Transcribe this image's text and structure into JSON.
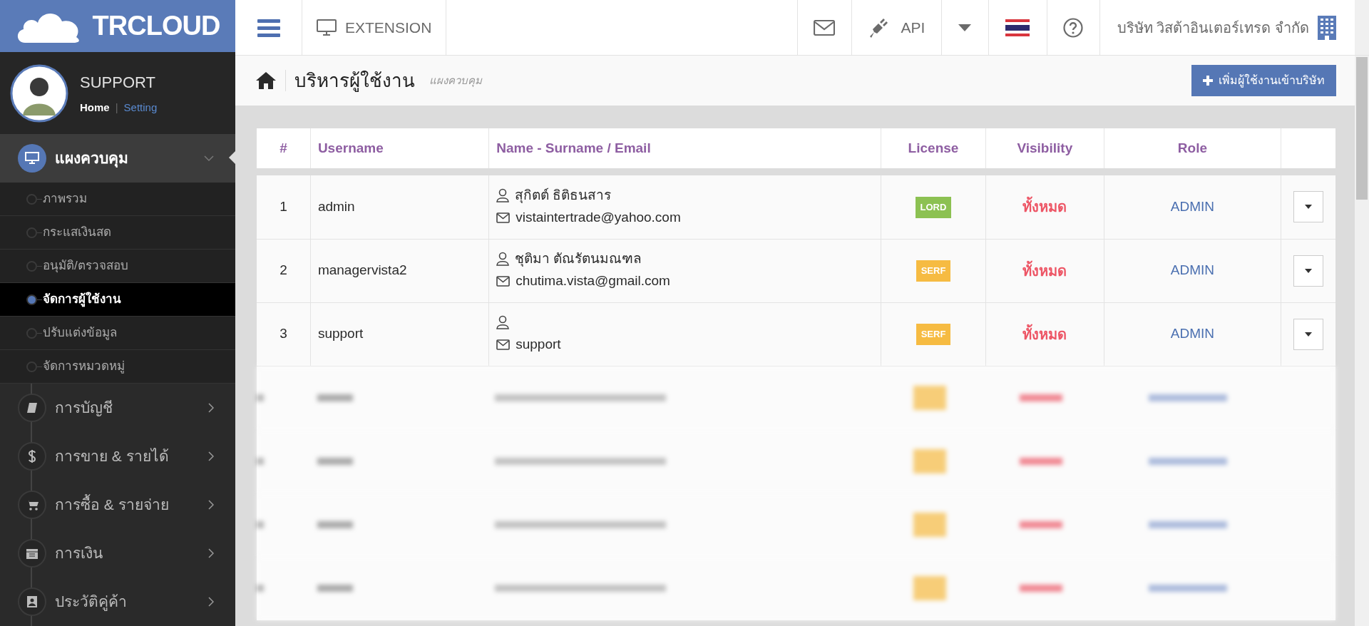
{
  "logo": {
    "text": "TRCLOUD"
  },
  "profile": {
    "name": "SUPPORT",
    "separator": "|",
    "links": [
      {
        "label": "Home",
        "selected": true
      },
      {
        "label": "Setting",
        "selected": false
      }
    ]
  },
  "sidebar": {
    "items": [
      {
        "label": "แผงควบคุม",
        "expanded": true,
        "children": [
          {
            "label": "ภาพรวม",
            "selected": false
          },
          {
            "label": "กระแสเงินสด",
            "selected": false
          },
          {
            "label": "อนุมัติ/ตรวจสอบ",
            "selected": false
          },
          {
            "label": "จัดการผู้ใช้งาน",
            "selected": true
          },
          {
            "label": "ปรับแต่งข้อมูล",
            "selected": false
          },
          {
            "label": "จัดการหมวดหมู่",
            "selected": false
          }
        ]
      },
      {
        "label": "การบัญชี",
        "expanded": false
      },
      {
        "label": "การขาย & รายได้",
        "expanded": false
      },
      {
        "label": "การซื้อ & รายจ่าย",
        "expanded": false
      },
      {
        "label": "การเงิน",
        "expanded": false
      },
      {
        "label": "ประวัติคู่ค้า",
        "expanded": false
      }
    ]
  },
  "topbar": {
    "extension": "EXTENSION",
    "api": "API",
    "company": "บริษัท วิสต้าอินเตอร์เทรด จำกัด"
  },
  "page_header": {
    "title": "บริหารผู้ใช้งาน",
    "breadcrumb": "แผงควบคุม",
    "add_button": "เพิ่มผู้ใช้งานเข้าบริษัท"
  },
  "table": {
    "columns": [
      "#",
      "Username",
      "Name - Surname / Email",
      "License",
      "Visibility",
      "Role"
    ],
    "rows": [
      {
        "kind": "user",
        "number": "1",
        "username": "admin",
        "full_name": "สุกิตต์ ธิติธนสาร",
        "email": "vistaintertrade@yahoo.com",
        "license": {
          "label": "LORD",
          "color": "#8cc152"
        },
        "visibility": "ทั้งหมด",
        "role": "ADMIN"
      },
      {
        "kind": "user",
        "number": "2",
        "username": "managervista2",
        "full_name": "ชุติมา ตัณรัตนมณฑล",
        "email": "chutima.vista@gmail.com",
        "license": {
          "label": "SERF",
          "color": "#f6bb42"
        },
        "visibility": "ทั้งหมด",
        "role": "ADMIN"
      },
      {
        "kind": "user",
        "number": "3",
        "username": "support",
        "email": "support",
        "license": {
          "label": "SERF",
          "color": "#f6bb42"
        },
        "visibility": "ทั้งหมด",
        "role": "ADMIN"
      },
      {
        "kind": "blurred"
      },
      {
        "kind": "blurred"
      },
      {
        "kind": "blurred"
      },
      {
        "kind": "blurred"
      }
    ]
  }
}
